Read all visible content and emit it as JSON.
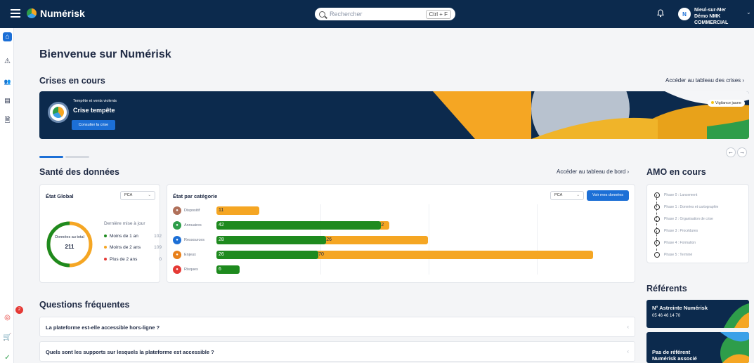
{
  "topbar": {
    "brand": "Numérisk",
    "search_placeholder": "Rechercher",
    "shortcut": "Ctrl + F",
    "user_initial": "N",
    "user_location": "Nieul-sur-Mer",
    "user_org": "Démo NMK COMMERCIAL"
  },
  "sidebar": {
    "items": [
      "home-icon",
      "alert-icon",
      "users-icon",
      "contacts-icon",
      "document-icon"
    ],
    "bottom": [
      "target-icon",
      "cart-icon",
      "check-icon"
    ],
    "notif_count": "2"
  },
  "page": {
    "title": "Bienvenue sur Numérisk"
  },
  "crises": {
    "title": "Crises en cours",
    "link": "Accéder au tableau des crises",
    "banner": {
      "kicker": "Tempête et vents violents",
      "title": "Crise tempête",
      "button": "Consulter la crise",
      "badge": "Vigilance jaune"
    }
  },
  "sante": {
    "title": "Santé des données",
    "link": "Accéder au tableau de bord",
    "global": {
      "title": "État Global",
      "select": "PCA",
      "donut_label": "Données au total",
      "donut_total": "211",
      "last_update": "Dernière mise à jour",
      "legend": [
        {
          "label": "Moins de 1 an",
          "value": "102",
          "color": "#1e8a1e"
        },
        {
          "label": "Moins de 2 ans",
          "value": "109",
          "color": "#f5a623"
        },
        {
          "label": "Plus de 2 ans",
          "value": "0",
          "color": "#e53935"
        }
      ]
    },
    "categories": {
      "title": "État par catégorie",
      "select": "PCA",
      "button": "Voir mes données",
      "rows": [
        {
          "label": "Dispositif",
          "green": 0,
          "orange": 11,
          "icon_color": "#b0705a"
        },
        {
          "label": "Annuaires",
          "green": 42,
          "orange": 2,
          "icon_color": "#2e9d4a"
        },
        {
          "label": "Ressources",
          "green": 28,
          "orange": 26,
          "icon_color": "#1c6fd6"
        },
        {
          "label": "Enjeux",
          "green": 26,
          "orange": 70,
          "icon_color": "#e8801a"
        },
        {
          "label": "Risques",
          "green": 6,
          "orange": 0,
          "icon_color": "#e53935"
        }
      ]
    }
  },
  "amo": {
    "title": "AMO en cours",
    "phases": [
      "Phase 0 : Lancement",
      "Phase 1 : Données et cartographie",
      "Phase 2 : Organisation de crise",
      "Phase 3 : Procédures",
      "Phase 4 : Formation",
      "Phase 5 : Terminé"
    ]
  },
  "referents": {
    "title": "Référents",
    "astreinte_title": "N° Astreinte Numérisk",
    "astreinte_phone": "05 46 46 14 70",
    "none_line1": "Pas de référent",
    "none_line2": "Numérisk associé"
  },
  "faq": {
    "title": "Questions fréquentes",
    "items": [
      "La plateforme est-elle accessible hors-ligne ?",
      "Quels sont les supports sur lesquels la plateforme est accessible ?"
    ]
  }
}
